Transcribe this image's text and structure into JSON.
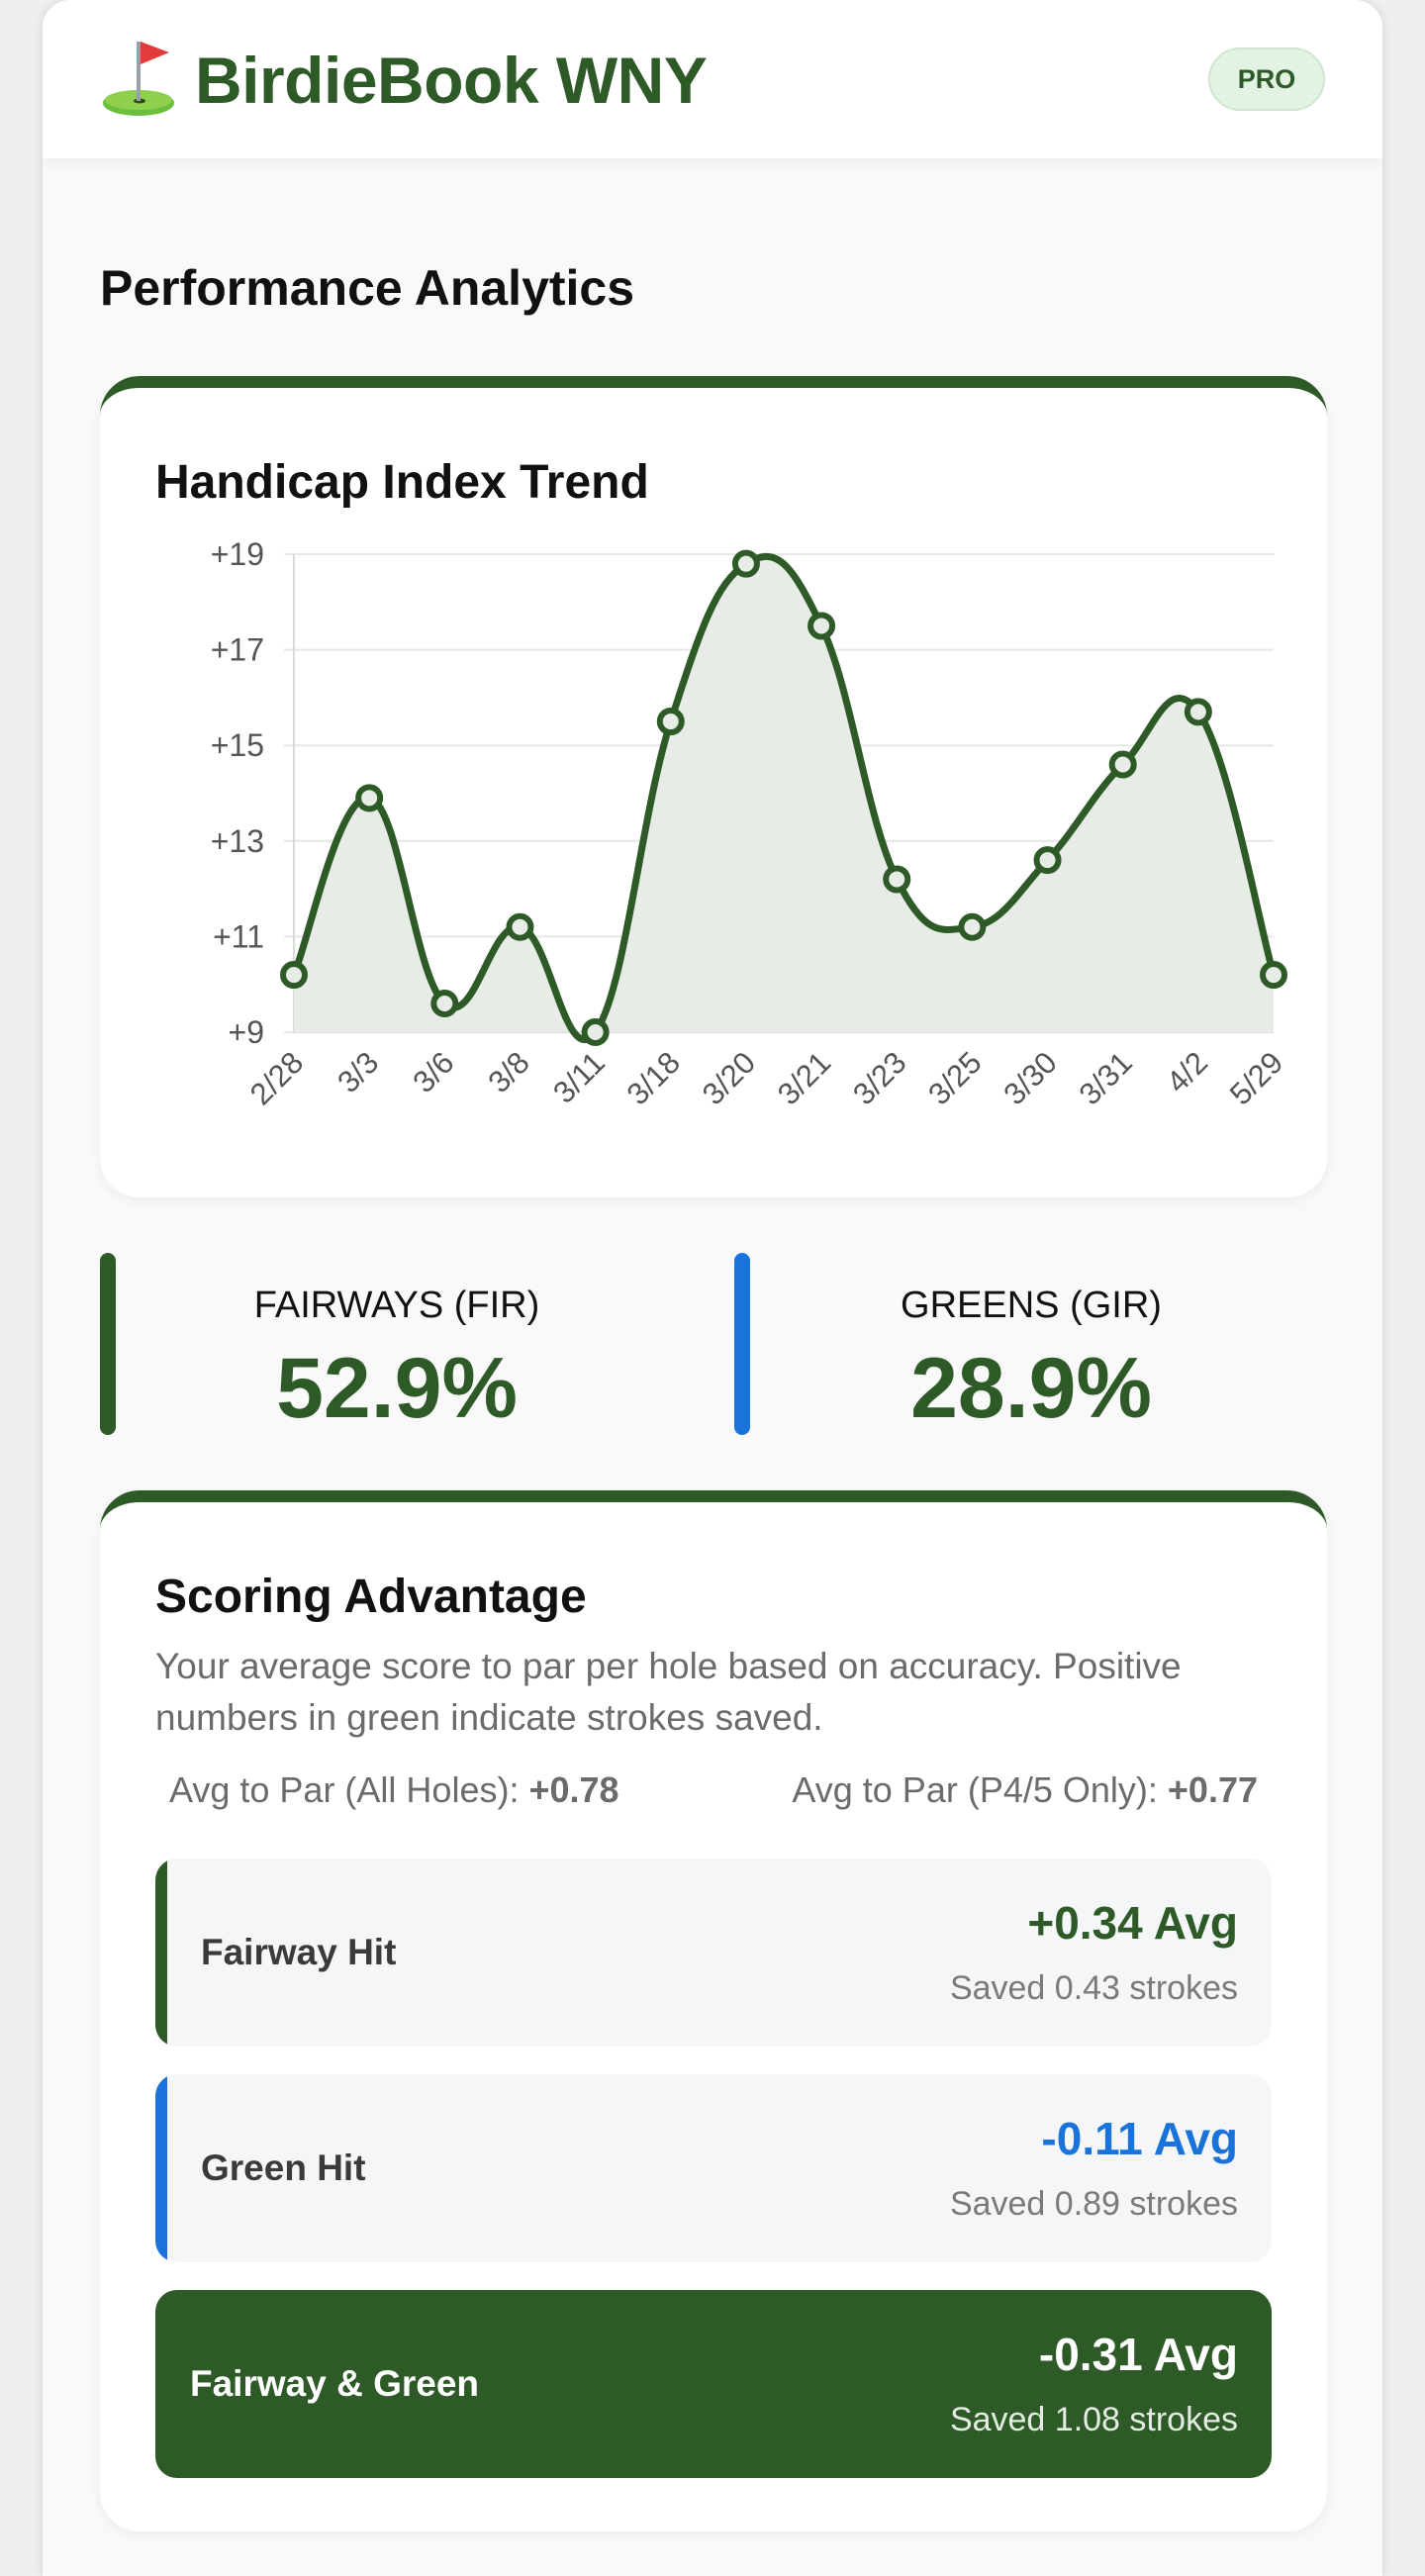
{
  "app": {
    "brand_icon": "golf-flag-icon",
    "title": "BirdieBook WNY",
    "badge": "PRO"
  },
  "page": {
    "title": "Performance Analytics"
  },
  "colors": {
    "primary_green": "#2d5a27",
    "accent_blue": "#1a73d9",
    "badge_bg": "#e3f3e3"
  },
  "chart_data": {
    "type": "area",
    "title": "Handicap Index Trend",
    "xlabel": "",
    "ylabel": "",
    "categories": [
      "2/28",
      "3/3",
      "3/6",
      "3/8",
      "3/11",
      "3/18",
      "3/20",
      "3/21",
      "3/23",
      "3/25",
      "3/30",
      "3/31",
      "4/2",
      "5/29"
    ],
    "series": [
      {
        "values": [
          10.2,
          13.9,
          9.6,
          11.2,
          9.0,
          15.5,
          18.8,
          17.5,
          12.2,
          11.2,
          12.6,
          14.6,
          15.7,
          10.2
        ]
      }
    ],
    "ylim": [
      9,
      19
    ],
    "yticks": [
      9,
      11,
      13,
      15,
      17,
      19
    ],
    "ytick_labels": [
      "+9",
      "+11",
      "+13",
      "+15",
      "+17",
      "+19"
    ],
    "grid": true,
    "legend": "none",
    "line_color": "#2d5a27",
    "fill_color": "#e8ece7"
  },
  "stats": {
    "fir": {
      "label": "FAIRWAYS (FIR)",
      "value": "52.9%",
      "bar_color": "#2d5a27"
    },
    "gir": {
      "label": "GREENS (GIR)",
      "value": "28.9%",
      "bar_color": "#1a73d9"
    }
  },
  "scoring": {
    "title": "Scoring Advantage",
    "description": "Your average score to par per hole based on accuracy. Positive numbers in green indicate strokes saved.",
    "avg_all_label": "Avg to Par (All Holes):",
    "avg_all_value": "+0.78",
    "avg_p45_label": "Avg to Par (P4/5 Only):",
    "avg_p45_value": "+0.77",
    "rows": [
      {
        "label": "Fairway Hit",
        "avg": "+0.34 Avg",
        "saved": "Saved 0.43 strokes",
        "color": "#2d5a27"
      },
      {
        "label": "Green Hit",
        "avg": "-0.11 Avg",
        "saved": "Saved 0.89 strokes",
        "color": "#1a73d9"
      },
      {
        "label": "Fairway & Green",
        "avg": "-0.31 Avg",
        "saved": "Saved 1.08 strokes",
        "color": "#ffffff"
      }
    ]
  }
}
